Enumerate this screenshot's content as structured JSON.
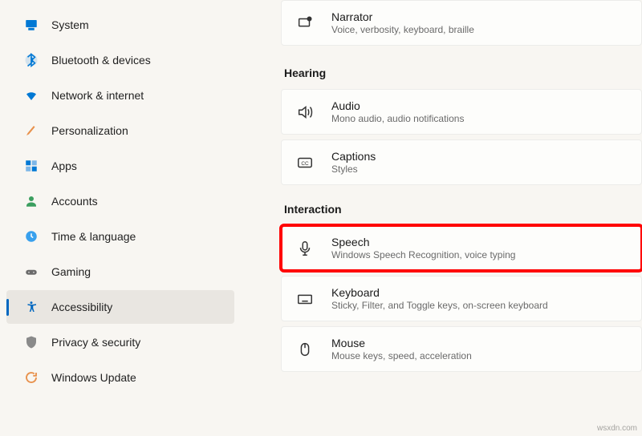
{
  "sidebar": {
    "items": [
      {
        "label": "System"
      },
      {
        "label": "Bluetooth & devices"
      },
      {
        "label": "Network & internet"
      },
      {
        "label": "Personalization"
      },
      {
        "label": "Apps"
      },
      {
        "label": "Accounts"
      },
      {
        "label": "Time & language"
      },
      {
        "label": "Gaming"
      },
      {
        "label": "Accessibility"
      },
      {
        "label": "Privacy & security"
      },
      {
        "label": "Windows Update"
      }
    ]
  },
  "main": {
    "narrator": {
      "title": "Narrator",
      "desc": "Voice, verbosity, keyboard, braille"
    },
    "section_hearing": "Hearing",
    "audio": {
      "title": "Audio",
      "desc": "Mono audio, audio notifications"
    },
    "captions": {
      "title": "Captions",
      "desc": "Styles"
    },
    "section_interaction": "Interaction",
    "speech": {
      "title": "Speech",
      "desc": "Windows Speech Recognition, voice typing"
    },
    "keyboard": {
      "title": "Keyboard",
      "desc": "Sticky, Filter, and Toggle keys, on-screen keyboard"
    },
    "mouse": {
      "title": "Mouse",
      "desc": "Mouse keys, speed, acceleration"
    }
  },
  "watermark": "wsxdn.com"
}
